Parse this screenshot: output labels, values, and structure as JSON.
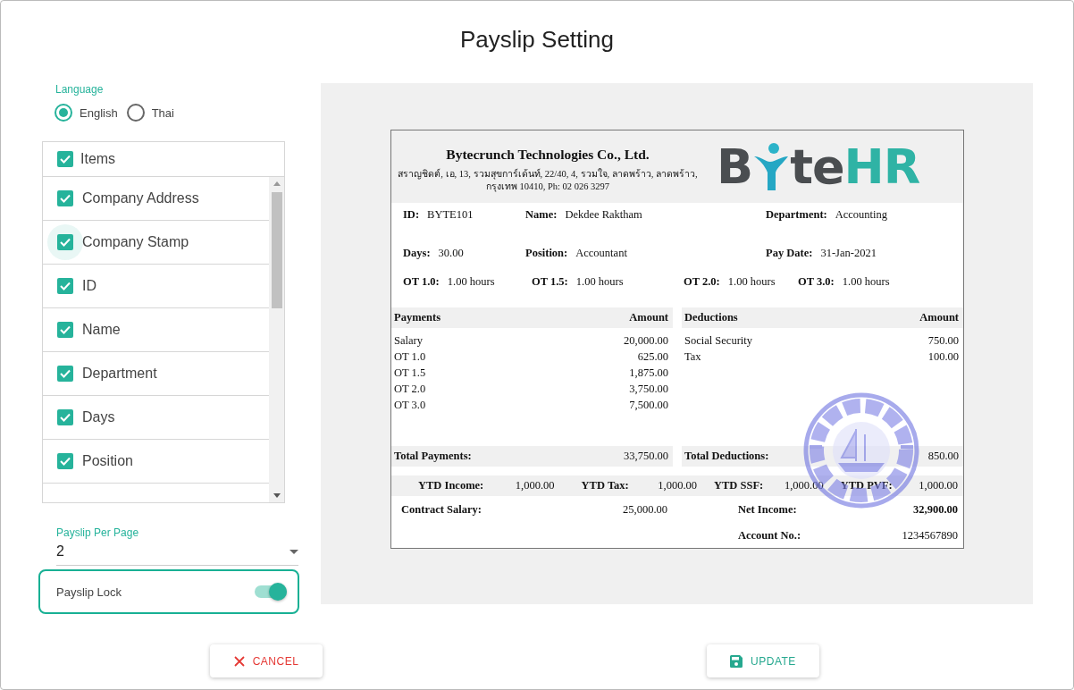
{
  "title": "Payslip Setting",
  "language": {
    "label": "Language",
    "options": [
      {
        "label": "English",
        "selected": true
      },
      {
        "label": "Thai",
        "selected": false
      }
    ]
  },
  "items": {
    "header": {
      "label": "Items",
      "checked": true
    },
    "rows": [
      {
        "label": "Company Address",
        "checked": true,
        "focused": false
      },
      {
        "label": "Company Stamp",
        "checked": true,
        "focused": true
      },
      {
        "label": "ID",
        "checked": true,
        "focused": false
      },
      {
        "label": "Name",
        "checked": true,
        "focused": false
      },
      {
        "label": "Department",
        "checked": true,
        "focused": false
      },
      {
        "label": "Days",
        "checked": true,
        "focused": false
      },
      {
        "label": "Position",
        "checked": true,
        "focused": false
      }
    ]
  },
  "per_page": {
    "label": "Payslip Per Page",
    "value": "2"
  },
  "lock": {
    "label": "Payslip Lock",
    "on": true
  },
  "payslip": {
    "company_name": "Bytecrunch Technologies Co., Ltd.",
    "address_lines": [
      "สราญชิดต์, เอ, 13, รวมสุขการ์เด้นท์, 22/40, 4, รวมใจ, ลาดพร้าว, ลาดพร้าว,",
      "กรุงเทพ 10410, Ph: 02 026 3297"
    ],
    "logo": {
      "before": "B",
      "after": "te",
      "accent": "HR"
    },
    "info_rows": [
      [
        {
          "label": "ID:",
          "value": "BYTE101"
        },
        {
          "label": "Name:",
          "value": "Dekdee Raktham"
        },
        {
          "label": "Department:",
          "value": "Accounting"
        }
      ],
      [
        {
          "label": "Days:",
          "value": "30.00"
        },
        {
          "label": "Position:",
          "value": "Accountant"
        },
        {
          "label": "Pay Date:",
          "value": "31-Jan-2021"
        }
      ],
      [
        {
          "label": "OT 1.0:",
          "value": "1.00 hours"
        },
        {
          "label": "OT 1.5:",
          "value": "1.00 hours"
        },
        {
          "label": "OT 2.0:",
          "value": "1.00 hours"
        },
        {
          "label": "OT 3.0:",
          "value": "1.00 hours"
        }
      ]
    ],
    "tables": [
      {
        "header": [
          "Payments",
          "Amount"
        ],
        "rows": [
          [
            "Salary",
            "20,000.00"
          ],
          [
            "OT 1.0",
            "625.00"
          ],
          [
            "OT 1.5",
            "1,875.00"
          ],
          [
            "OT 2.0",
            "3,750.00"
          ],
          [
            "OT 3.0",
            "7,500.00"
          ]
        ],
        "total": [
          "Total Payments:",
          "33,750.00"
        ]
      },
      {
        "header": [
          "Deductions",
          "Amount"
        ],
        "rows": [
          [
            "Social Security",
            "750.00"
          ],
          [
            "Tax",
            "100.00"
          ]
        ],
        "total": [
          "Total Deductions:",
          "850.00"
        ]
      }
    ],
    "ytd": [
      {
        "label": "YTD Income:",
        "value": "1,000.00"
      },
      {
        "label": "YTD Tax:",
        "value": "1,000.00"
      },
      {
        "label": "YTD SSF:",
        "value": "1,000.00"
      },
      {
        "label": "YTD PVF:",
        "value": "1,000.00"
      }
    ],
    "contract": {
      "label": "Contract Salary:",
      "value": "25,000.00"
    },
    "net": {
      "label": "Net Income:",
      "value": "32,900.00"
    },
    "account": {
      "label": "Account No.:",
      "value": "1234567890"
    },
    "stamp": {
      "kind": "picture"
    }
  },
  "buttons": [
    {
      "kind": "cancel",
      "label": "CANCEL"
    },
    {
      "kind": "update",
      "label": "UPDATE"
    }
  ]
}
